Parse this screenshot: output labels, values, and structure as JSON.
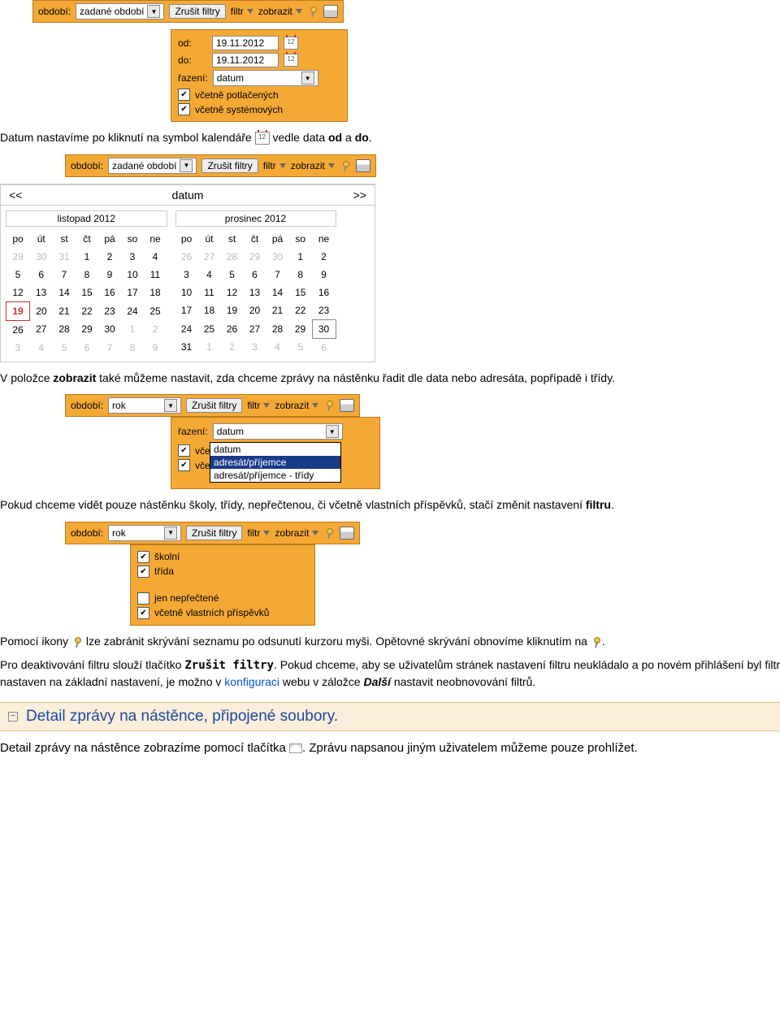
{
  "bar1": {
    "obdobi_label": "období:",
    "obdobi_value": "zadané období",
    "zrusit": "Zrušit filtry",
    "filtr": "filtr",
    "zobrazit": "zobrazit"
  },
  "panel1": {
    "od_label": "od:",
    "od_value": "19.11.2012",
    "do_label": "do:",
    "do_value": "19.11.2012",
    "razeni_label": "řazení:",
    "razeni_value": "datum",
    "chk1": "včetně potlačených",
    "chk2": "včetně systémových"
  },
  "para1_a": "Datum nastavíme po kliknutí na symbol kalendáře ",
  "para1_b": " vedle data ",
  "para1_od": "od",
  "para1_a2": " a ",
  "para1_do": "do",
  "para1_end": ".",
  "bar2": {
    "obdobi_value": "zadané období"
  },
  "calendar": {
    "prev": "<<",
    "title": "datum",
    "next": ">>",
    "month1": "listopad 2012",
    "month2": "prosinec 2012",
    "days": [
      "po",
      "út",
      "st",
      "čt",
      "pá",
      "so",
      "ne"
    ]
  },
  "para2_a": "V položce ",
  "para2_zobrazit": "zobrazit",
  "para2_b": " také můžeme nastavit, zda chceme zprávy na nástěnku řadit dle data nebo adresáta, popřípadě i třídy.",
  "bar3_value": "rok",
  "panel3": {
    "razeni": "řazení:",
    "val": "datum",
    "vcet": "včet",
    "opt1": "datum",
    "opt2": "adresát/příjemce",
    "opt3": "adresát/příjemce - třídy"
  },
  "para3": "Pokud chceme vidět pouze nástěnku školy, třídy, nepřečtenou, či včetně vlastních příspěvků, stačí změnit nastavení ",
  "para3_filtru": "filtru",
  "panel4": {
    "c1": "školní",
    "c2": "třída",
    "c3": "jen nepřečtené",
    "c4": "včetně vlastních příspěvků"
  },
  "para4_a": "Pomocí ikony ",
  "para4_b": " lze zabránit skrývání seznamu po odsunutí kurzoru myši. Opětovné skrývání obnovíme kliknutím na ",
  "para4_c": ".",
  "para5_a": "Pro deaktivování filtru slouží tlačítko ",
  "para5_btn": "Zrušit filtry",
  "para5_b": ". Pokud chceme, aby se uživatelům stránek nastavení filtru neukládalo a po novém přihlášení byl filtr nastaven na základní nastavení, je možno v ",
  "para5_link": "konfiguraci",
  "para5_c": " webu v záložce ",
  "para5_dalsi": "Další",
  "para5_d": " nastavit neobnovování filtrů.",
  "section": "Detail zprávy na nástěnce, připojené soubory.",
  "para6_a": "Detail zprávy na nástěnce zobrazíme pomocí tlačítka ",
  "para6_b": ". Zprávu napsanou jiným uživatelem můžeme pouze prohlížet."
}
